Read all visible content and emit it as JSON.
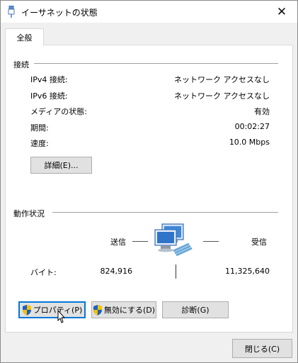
{
  "window": {
    "title": "イーサネットの状態",
    "close_glyph": "✕"
  },
  "tabs": [
    {
      "label": "全般"
    }
  ],
  "connection": {
    "header": "接続",
    "rows": [
      {
        "label": "IPv4 接続:",
        "value": "ネットワーク アクセスなし"
      },
      {
        "label": "IPv6 接続:",
        "value": "ネットワーク アクセスなし"
      },
      {
        "label": "メディアの状態:",
        "value": "有効"
      },
      {
        "label": "期間:",
        "value": "00:02:27"
      },
      {
        "label": "速度:",
        "value": "10.0 Mbps"
      }
    ],
    "details_button": "詳細(E)..."
  },
  "activity": {
    "header": "動作状況",
    "sent_label": "送信",
    "received_label": "受信",
    "bytes_label": "バイト:",
    "bytes_sent": "824,916",
    "bytes_received": "11,325,640"
  },
  "buttons": {
    "properties": "プロパティ(P)",
    "disable": "無効にする(D)",
    "diagnose": "診断(G)",
    "close": "閉じる(C)"
  },
  "icons": {
    "title": "ethernet-connector-icon",
    "network": "network-computers-icon",
    "shield": "uac-shield-icon"
  },
  "colors": {
    "accent": "#0078d7",
    "shield_blue": "#1f5fbf",
    "shield_yellow": "#f2c200"
  }
}
